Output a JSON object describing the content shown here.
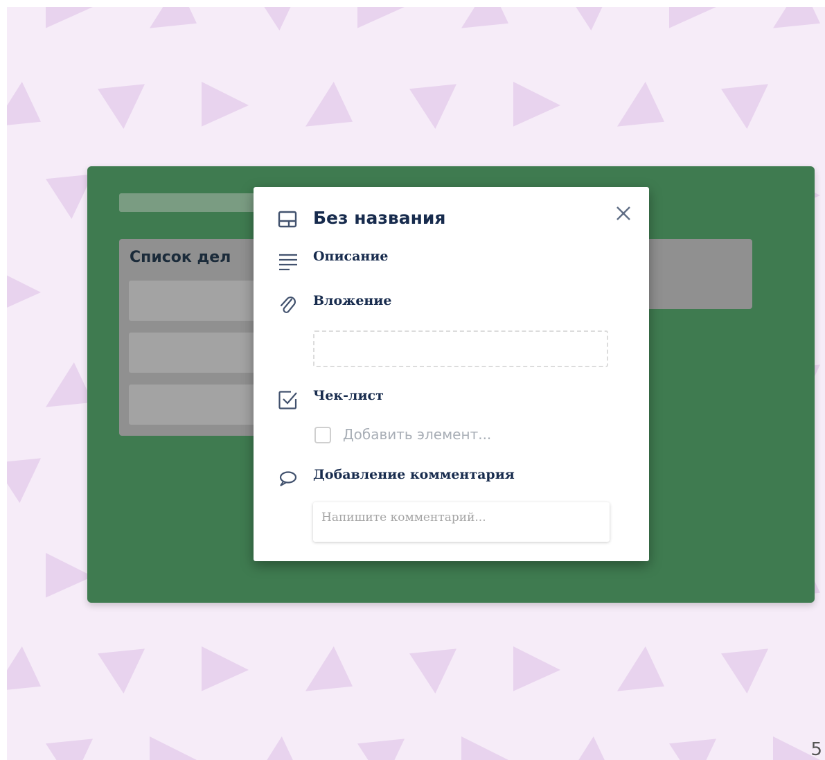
{
  "board": {
    "list": {
      "title": "Список дел"
    }
  },
  "card_modal": {
    "title": "Без названия",
    "sections": {
      "description": {
        "label": "Описание",
        "icon": "description-lines-icon"
      },
      "attachment": {
        "label": "Вложение",
        "icon": "paperclip-icon"
      },
      "checklist": {
        "label": "Чек-лист",
        "icon": "checklist-icon",
        "add_item_placeholder": "Добавить элемент..."
      },
      "comment": {
        "label": "Добавление комментария",
        "icon": "speech-bubble-icon",
        "placeholder": "Напишите комментарий..."
      }
    },
    "close_icon": "close-icon",
    "title_icon": "card-icon"
  },
  "footer": {
    "page_number": "5"
  },
  "colors": {
    "board_background": "#3f7b50",
    "page_pattern_background": "#f6ecf8",
    "pattern_triangle": "#e8d3ee",
    "list_background": "#909090",
    "modal_background": "#ffffff",
    "title_text": "#172b4d"
  }
}
